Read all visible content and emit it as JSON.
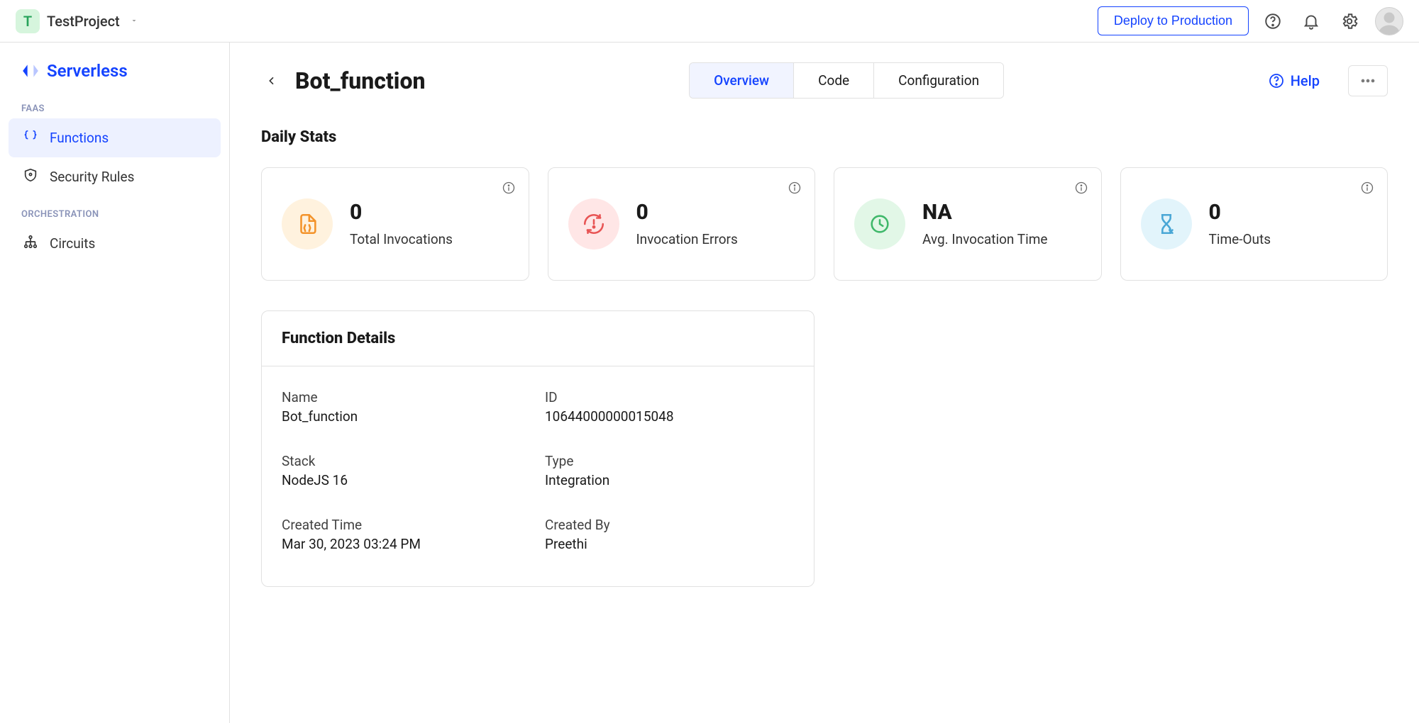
{
  "header": {
    "project_initial": "T",
    "project_name": "TestProject",
    "deploy_label": "Deploy to Production"
  },
  "sidebar": {
    "brand": "Serverless",
    "section_faas": "FAAS",
    "section_orch": "ORCHESTRATION",
    "items": {
      "functions": "Functions",
      "security_rules": "Security Rules",
      "circuits": "Circuits"
    }
  },
  "page": {
    "title": "Bot_function",
    "help_label": "Help",
    "tabs": {
      "overview": "Overview",
      "code": "Code",
      "configuration": "Configuration"
    },
    "stats_title": "Daily Stats",
    "stats": {
      "invocations": {
        "value": "0",
        "label": "Total Invocations"
      },
      "errors": {
        "value": "0",
        "label": "Invocation Errors"
      },
      "avg_time": {
        "value": "NA",
        "label": "Avg. Invocation Time"
      },
      "timeouts": {
        "value": "0",
        "label": "Time-Outs"
      }
    },
    "details_title": "Function Details",
    "details": {
      "name_label": "Name",
      "name_value": "Bot_function",
      "id_label": "ID",
      "id_value": "10644000000015048",
      "stack_label": "Stack",
      "stack_value": "NodeJS 16",
      "type_label": "Type",
      "type_value": "Integration",
      "created_time_label": "Created Time",
      "created_time_value": "Mar 30, 2023 03:24 PM",
      "created_by_label": "Created By",
      "created_by_value": "Preethi"
    }
  }
}
